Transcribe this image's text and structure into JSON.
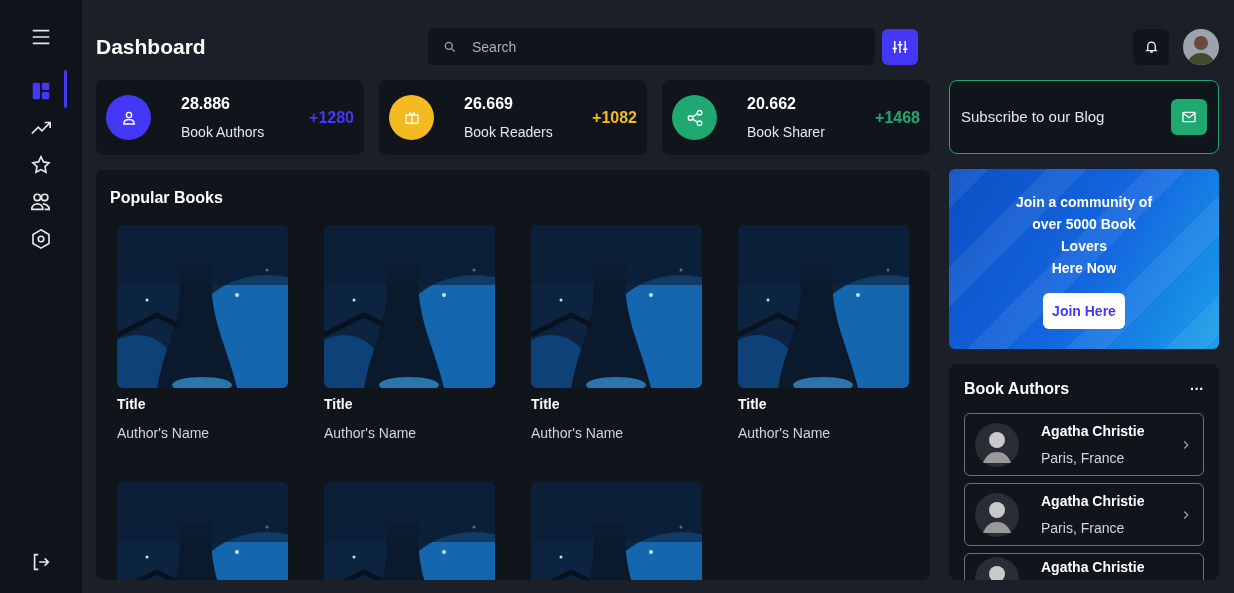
{
  "sidebar": {
    "items": [
      {
        "selected": true
      },
      {
        "selected": false
      },
      {
        "selected": false
      },
      {
        "selected": false
      },
      {
        "selected": false
      }
    ]
  },
  "header": {
    "title": "Dashboard",
    "search": {
      "placeholder": "Search"
    }
  },
  "stats": [
    {
      "value": "28.886",
      "label": "Book Authors",
      "change": "+1280",
      "color": "#4338f5"
    },
    {
      "value": "26.669",
      "label": "Book Readers",
      "change": "+1082",
      "color": "#f5b921"
    },
    {
      "value": "20.662",
      "label": "Book Sharer",
      "change": "+1468",
      "color": "#1fa971"
    }
  ],
  "popular_books": {
    "title": "Popular Books",
    "books": [
      {
        "kind": "book",
        "title": "Title",
        "author": "Author's Name"
      },
      {
        "kind": "book",
        "title": "Title",
        "author": "Author's Name"
      },
      {
        "kind": "book",
        "title": "Title",
        "author": "Author's Name"
      },
      {
        "kind": "book",
        "title": "Title",
        "author": "Author's Name"
      },
      {
        "kind": "picture"
      },
      {
        "kind": "picture"
      },
      {
        "kind": "picture"
      }
    ]
  },
  "subscribe": {
    "label": "Subscribe to our Blog"
  },
  "banner": {
    "lines": [
      "Join a community of",
      "over 5000 Book",
      "Lovers",
      "Here Now"
    ],
    "button": "Join Here"
  },
  "book_authors": {
    "title": "Book Authors",
    "menu": "···",
    "authors": [
      {
        "name": "Agatha Christie",
        "location": "Paris, France"
      },
      {
        "name": "Agatha Christie",
        "location": "Paris, France"
      },
      {
        "name": "Agatha Christie"
      }
    ]
  }
}
